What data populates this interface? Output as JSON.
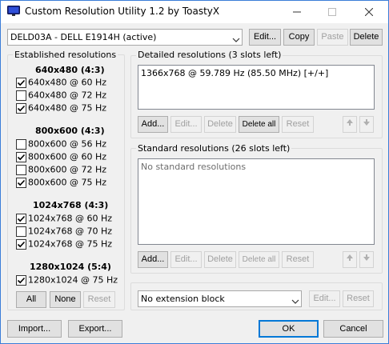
{
  "window": {
    "title": "Custom Resolution Utility 1.2 by ToastyX"
  },
  "monitor": {
    "selected": "DELD03A - DELL E1914H (active)",
    "buttons": {
      "edit": "Edit...",
      "copy": "Copy",
      "paste": "Paste",
      "delete": "Delete"
    }
  },
  "established": {
    "title": "Established resolutions",
    "groups": [
      {
        "heading": "640x480 (4:3)",
        "items": [
          {
            "label": "640x480 @ 60 Hz",
            "checked": true
          },
          {
            "label": "640x480 @ 72 Hz",
            "checked": false
          },
          {
            "label": "640x480 @ 75 Hz",
            "checked": true
          }
        ]
      },
      {
        "heading": "800x600 (4:3)",
        "items": [
          {
            "label": "800x600 @ 56 Hz",
            "checked": false
          },
          {
            "label": "800x600 @ 60 Hz",
            "checked": true
          },
          {
            "label": "800x600 @ 72 Hz",
            "checked": false
          },
          {
            "label": "800x600 @ 75 Hz",
            "checked": true
          }
        ]
      },
      {
        "heading": "1024x768 (4:3)",
        "items": [
          {
            "label": "1024x768 @ 60 Hz",
            "checked": true
          },
          {
            "label": "1024x768 @ 70 Hz",
            "checked": false
          },
          {
            "label": "1024x768 @ 75 Hz",
            "checked": true
          }
        ]
      },
      {
        "heading": "1280x1024 (5:4)",
        "items": [
          {
            "label": "1280x1024 @ 75 Hz",
            "checked": true
          }
        ]
      }
    ],
    "buttons": {
      "all": "All",
      "none": "None",
      "reset": "Reset"
    }
  },
  "detailed": {
    "title": "Detailed resolutions (3 slots left)",
    "items": [
      "1366x768 @ 59.789 Hz (85.50 MHz) [+/+]"
    ],
    "buttons": {
      "add": "Add...",
      "edit": "Edit...",
      "delete": "Delete",
      "delete_all": "Delete all",
      "reset": "Reset"
    }
  },
  "standard": {
    "title": "Standard resolutions (26 slots left)",
    "empty_text": "No standard resolutions",
    "buttons": {
      "add": "Add...",
      "edit": "Edit...",
      "delete": "Delete",
      "delete_all": "Delete all",
      "reset": "Reset"
    }
  },
  "extension": {
    "selected": "No extension block",
    "buttons": {
      "edit": "Edit...",
      "reset": "Reset"
    }
  },
  "footer": {
    "import": "Import...",
    "export": "Export...",
    "ok": "OK",
    "cancel": "Cancel"
  },
  "colors": {
    "accent": "#0078d7",
    "window_bg": "#f0f0f0"
  },
  "icons": {
    "app": "monitor-icon",
    "up": "arrow-up-icon",
    "down": "arrow-down-icon"
  }
}
